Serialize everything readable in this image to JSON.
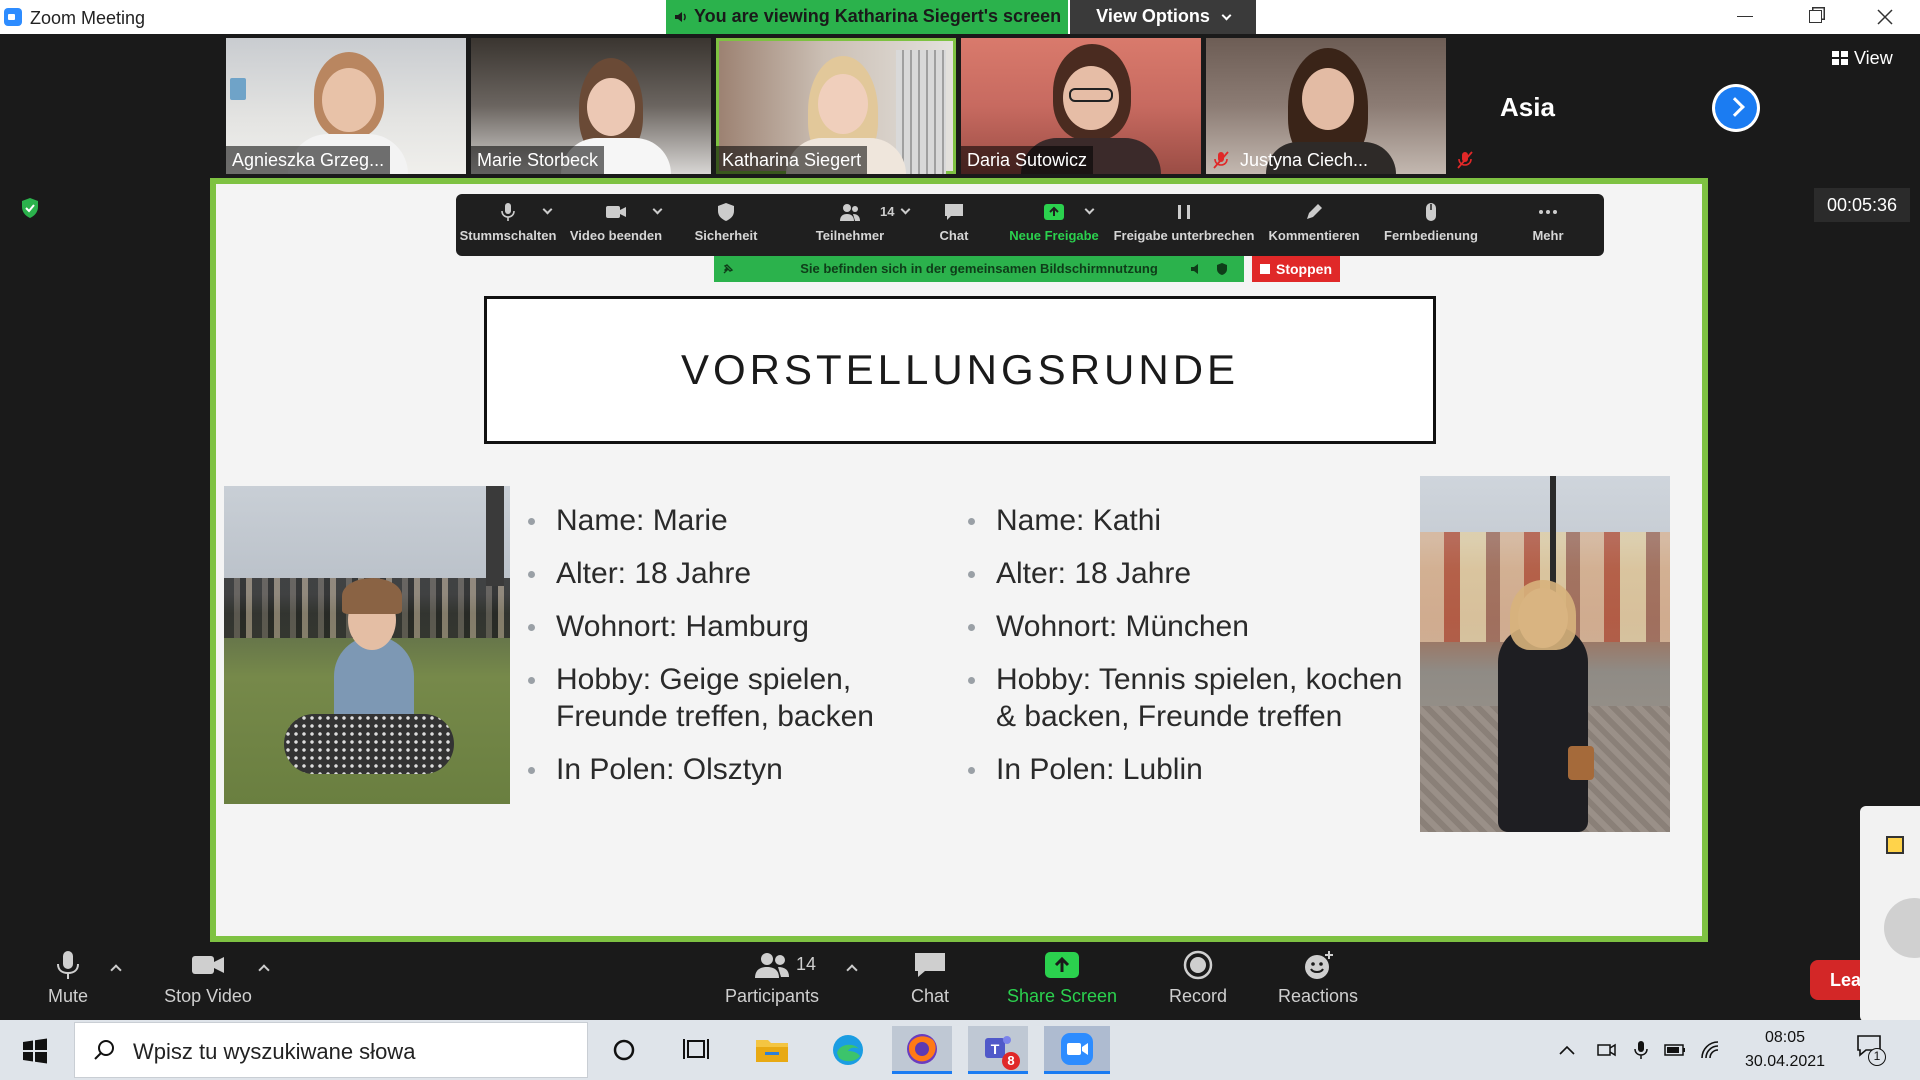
{
  "window": {
    "title": "Zoom Meeting"
  },
  "banner": {
    "viewing_text": "You are viewing Katharina Siegert's screen",
    "view_options_label": "View Options"
  },
  "participants": [
    {
      "name": "Agnieszka Grzeg..."
    },
    {
      "name": "Marie Storbeck"
    },
    {
      "name": "Katharina Siegert"
    },
    {
      "name": "Daria Sutowicz"
    },
    {
      "name": "Justyna Ciech..."
    }
  ],
  "extra_participant": {
    "name": "Asia"
  },
  "view_label": "View",
  "timer": "00:05:36",
  "presenter_toolbar": {
    "items": [
      {
        "label": "Stummschalten"
      },
      {
        "label": "Video beenden"
      },
      {
        "label": "Sicherheit"
      },
      {
        "label": "Teilnehmer",
        "count": "14"
      },
      {
        "label": "Chat"
      },
      {
        "label": "Neue Freigabe"
      },
      {
        "label": "Freigabe unterbrechen"
      },
      {
        "label": "Kommentieren"
      },
      {
        "label": "Fernbedienung"
      },
      {
        "label": "Mehr"
      }
    ],
    "share_banner": "Sie befinden sich in der gemeinsamen Bildschirmnutzung",
    "stop_label": "Stoppen"
  },
  "slide": {
    "title": "VORSTELLUNGSRUNDE",
    "left_list": [
      "Name: Marie",
      "Alter: 18 Jahre",
      "Wohnort: Hamburg",
      "Hobby: Geige spielen, Freunde treffen, backen",
      "In Polen: Olsztyn"
    ],
    "right_list": [
      "Name: Kathi",
      "Alter: 18 Jahre",
      "Wohnort: München",
      "Hobby: Tennis spielen, kochen & backen, Freunde treffen",
      "In Polen: Lublin"
    ]
  },
  "controls": {
    "mute": "Mute",
    "stop_video": "Stop Video",
    "participants": "Participants",
    "participants_count": "14",
    "chat": "Chat",
    "share_screen": "Share Screen",
    "record": "Record",
    "reactions": "Reactions",
    "leave": "Lea"
  },
  "taskbar": {
    "search_placeholder": "Wpisz tu wyszukiwane słowa",
    "teams_badge": "8",
    "time": "08:05",
    "date": "30.04.2021",
    "notification_count": "1"
  },
  "colors": {
    "accent_green": "#2bb24c",
    "share_border": "#7ec242",
    "zoom_blue": "#2d8cff",
    "stop_red": "#e02828"
  }
}
